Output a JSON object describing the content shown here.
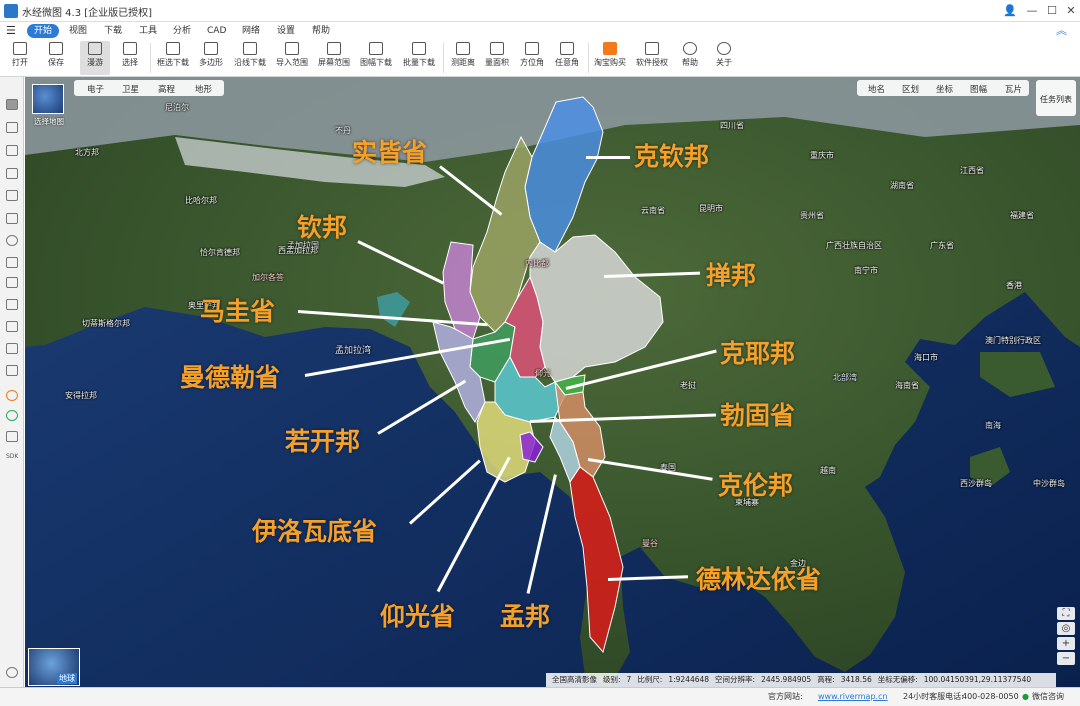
{
  "app": {
    "title": "水经微图 4.3 [企业版已授权]"
  },
  "menu": [
    "开始",
    "视图",
    "下载",
    "工具",
    "分析",
    "CAD",
    "网络",
    "设置",
    "帮助"
  ],
  "ribbon": [
    "打开",
    "保存",
    "漫游",
    "选择",
    "框选下载",
    "多边形",
    "沿线下载",
    "导入范围",
    "屏幕范围",
    "图幅下载",
    "批量下载",
    "测距离",
    "量面积",
    "方位角",
    "任意角",
    "淘宝购买",
    "软件授权",
    "帮助",
    "关于"
  ],
  "map_tabs_left": [
    "电子",
    "卫星",
    "高程",
    "地形"
  ],
  "map_tabs_right": [
    "地名",
    "区划",
    "坐标",
    "图幅",
    "瓦片"
  ],
  "task_list": "任务列表",
  "choose_map": "选择地图",
  "globe_label": "地球",
  "regions": [
    "实皆省",
    "克钦邦",
    "钦邦",
    "掸邦",
    "马圭省",
    "克耶邦",
    "曼德勒省",
    "勃固省",
    "若开邦",
    "克伦邦",
    "伊洛瓦底省",
    "德林达依省",
    "仰光省",
    "孟邦"
  ],
  "region_colors": {
    "kachin": "#4a8fe6",
    "sagaing": "#9da665",
    "chin": "#c783d6",
    "shan": "#dcdcdc",
    "magway": "#3fa060",
    "mandalay": "#e2507a",
    "kayah": "#46b84a",
    "bago": "#5ccdd8",
    "rakhine": "#b7b3e8",
    "kayin": "#d88f66",
    "ayeyarwady": "#e6e07e",
    "yangon": "#8a1ed8",
    "mon": "#b4d8e8",
    "tanintharyi": "#e01818"
  },
  "geo_labels": [
    "尼泊尔",
    "不丹",
    "孟加拉国",
    "加尔各答",
    "北方邦",
    "比哈尔邦",
    "西孟加拉邦",
    "恰尔肯德邦",
    "奥里萨邦",
    "安得拉邦",
    "孟加拉湾",
    "切蒂斯格尔邦",
    "云南省",
    "贵州省",
    "广西壮族自治区",
    "广东省",
    "老挝",
    "泰国",
    "柬埔寨",
    "越南",
    "海南省",
    "香港",
    "澳门特别行政区",
    "昆明市",
    "南宁市",
    "海口市",
    "北部湾",
    "西沙群岛",
    "中沙群岛",
    "曼谷",
    "金边",
    "内比都",
    "仰光",
    "南海",
    "四川省",
    "重庆市",
    "湖南省",
    "江西省",
    "福建省"
  ],
  "info_strip": [
    "全国高清影像",
    "级别:",
    "7",
    "比例尺:",
    "1:9244648",
    "空间分辨率:",
    "2445.984905",
    "高程:",
    "3418.56",
    "坐标无偏移:",
    "100.04150391,29.11377540"
  ],
  "status_bar": {
    "website_label": "官方网站:",
    "website": "www.rivermap.cn",
    "hotline": "24小时客服电话:",
    "phone": "400-028-0050",
    "wechat": "微信咨询"
  }
}
